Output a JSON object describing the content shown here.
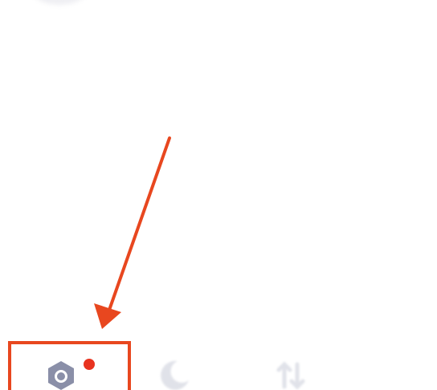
{
  "colors": {
    "annotation": "#e8471f",
    "icon_active": "#8a8fa8",
    "icon_inactive": "#bcc0cf",
    "badge": "#e8331f",
    "background": "#ffffff"
  },
  "tab_bar": {
    "tabs": [
      {
        "icon": "camera-icon",
        "has_badge": true,
        "highlighted": true
      },
      {
        "icon": "moon-icon",
        "has_badge": false,
        "highlighted": false
      },
      {
        "icon": "sort-arrows-icon",
        "has_badge": false,
        "highlighted": false
      }
    ]
  },
  "annotation": {
    "shape": "arrow-and-box",
    "target": "camera-icon"
  }
}
